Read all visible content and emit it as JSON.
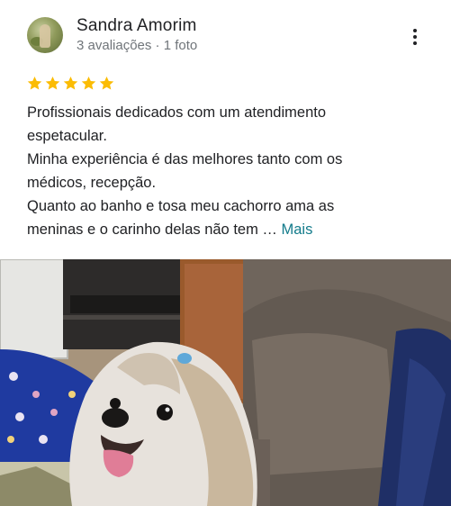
{
  "reviewer": {
    "name": "Sandra Amorim",
    "reviews_count": "3 avaliações",
    "separator": " · ",
    "photos_count": "1 foto"
  },
  "menu": {
    "icon": "more-vert-icon"
  },
  "rating": {
    "stars": 5,
    "max": 5,
    "color": "#fbbc04"
  },
  "review": {
    "lines": [
      "Profissionais dedicados com um atendimento",
      "espetacular.",
      "Minha experiência é das melhores tanto com os",
      "médicos, recepção.",
      "Quanto ao banho e tosa meu cachorro ama as",
      "meninas e o carinho delas não tem … "
    ],
    "more_label": "Mais"
  },
  "photo": {
    "subject": "dog-photo"
  }
}
